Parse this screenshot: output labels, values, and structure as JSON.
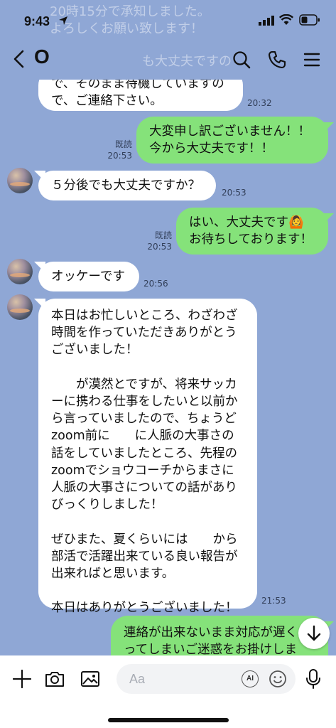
{
  "status": {
    "time": "9:43"
  },
  "ghost_lines": [
    "20時15分で承知しました。",
    "よろしくお願い致します！",
    "も大丈夫ですの"
  ],
  "header": {
    "title": "O"
  },
  "messages": [
    {
      "dir": "in",
      "text": "で、そのまま待機していますので、ご連絡下さい。",
      "display": "で、そのまま待機していますの\nで、ご連絡下さい。",
      "time": "20:32"
    },
    {
      "dir": "out",
      "text": "大変申し訳ございません！！\n今から大丈夫です！！",
      "read": "既読",
      "time": "20:53"
    },
    {
      "dir": "in",
      "text": "５分後でも大丈夫ですか？",
      "time": "20:53"
    },
    {
      "dir": "out",
      "text": "はい、大丈夫です🙆\nお待ちしております！",
      "read": "既読",
      "time": "20:53"
    },
    {
      "dir": "in",
      "text": "オッケーです",
      "time": "20:56"
    },
    {
      "dir": "in",
      "text": "本日はお忙しいところ、わざわざ\n時間を作っていただきありがとう\nございました！\n\n　　が漠然とですが、将来サッカ\nーに携わる仕事をしたいと以前か\nら言っていましたので、ちょうど\nzoom前に　　に人脈の大事さの\n話をしていましたところ、先程の\nzoomでショウコーチからまさに\n人脈の大事さについての話があり\nびっくりしました！\n\nぜひまた、夏くらいには　　から\n部活で活躍出来ている良い報告が\n出来ればと思います。\n\n本日はありがとうございました！",
      "time": "21:53"
    },
    {
      "dir": "out",
      "text": "連絡が出来ないまま対応が遅く\nってしまいご迷惑をお掛けしま"
    }
  ],
  "input": {
    "placeholder": "Aa",
    "ai_label": "AI"
  },
  "icons": {
    "back": "chevron-left-icon",
    "search": "search-icon",
    "call": "phone-icon",
    "menu": "menu-icon",
    "add": "plus-icon",
    "camera": "camera-icon",
    "image": "image-icon",
    "emoji": "emoji-icon",
    "mic": "microphone-icon",
    "scroll": "arrow-down-icon"
  },
  "colors": {
    "background": "#8fa7d5",
    "out_bubble": "#85e27a",
    "in_bubble": "#ffffff"
  }
}
